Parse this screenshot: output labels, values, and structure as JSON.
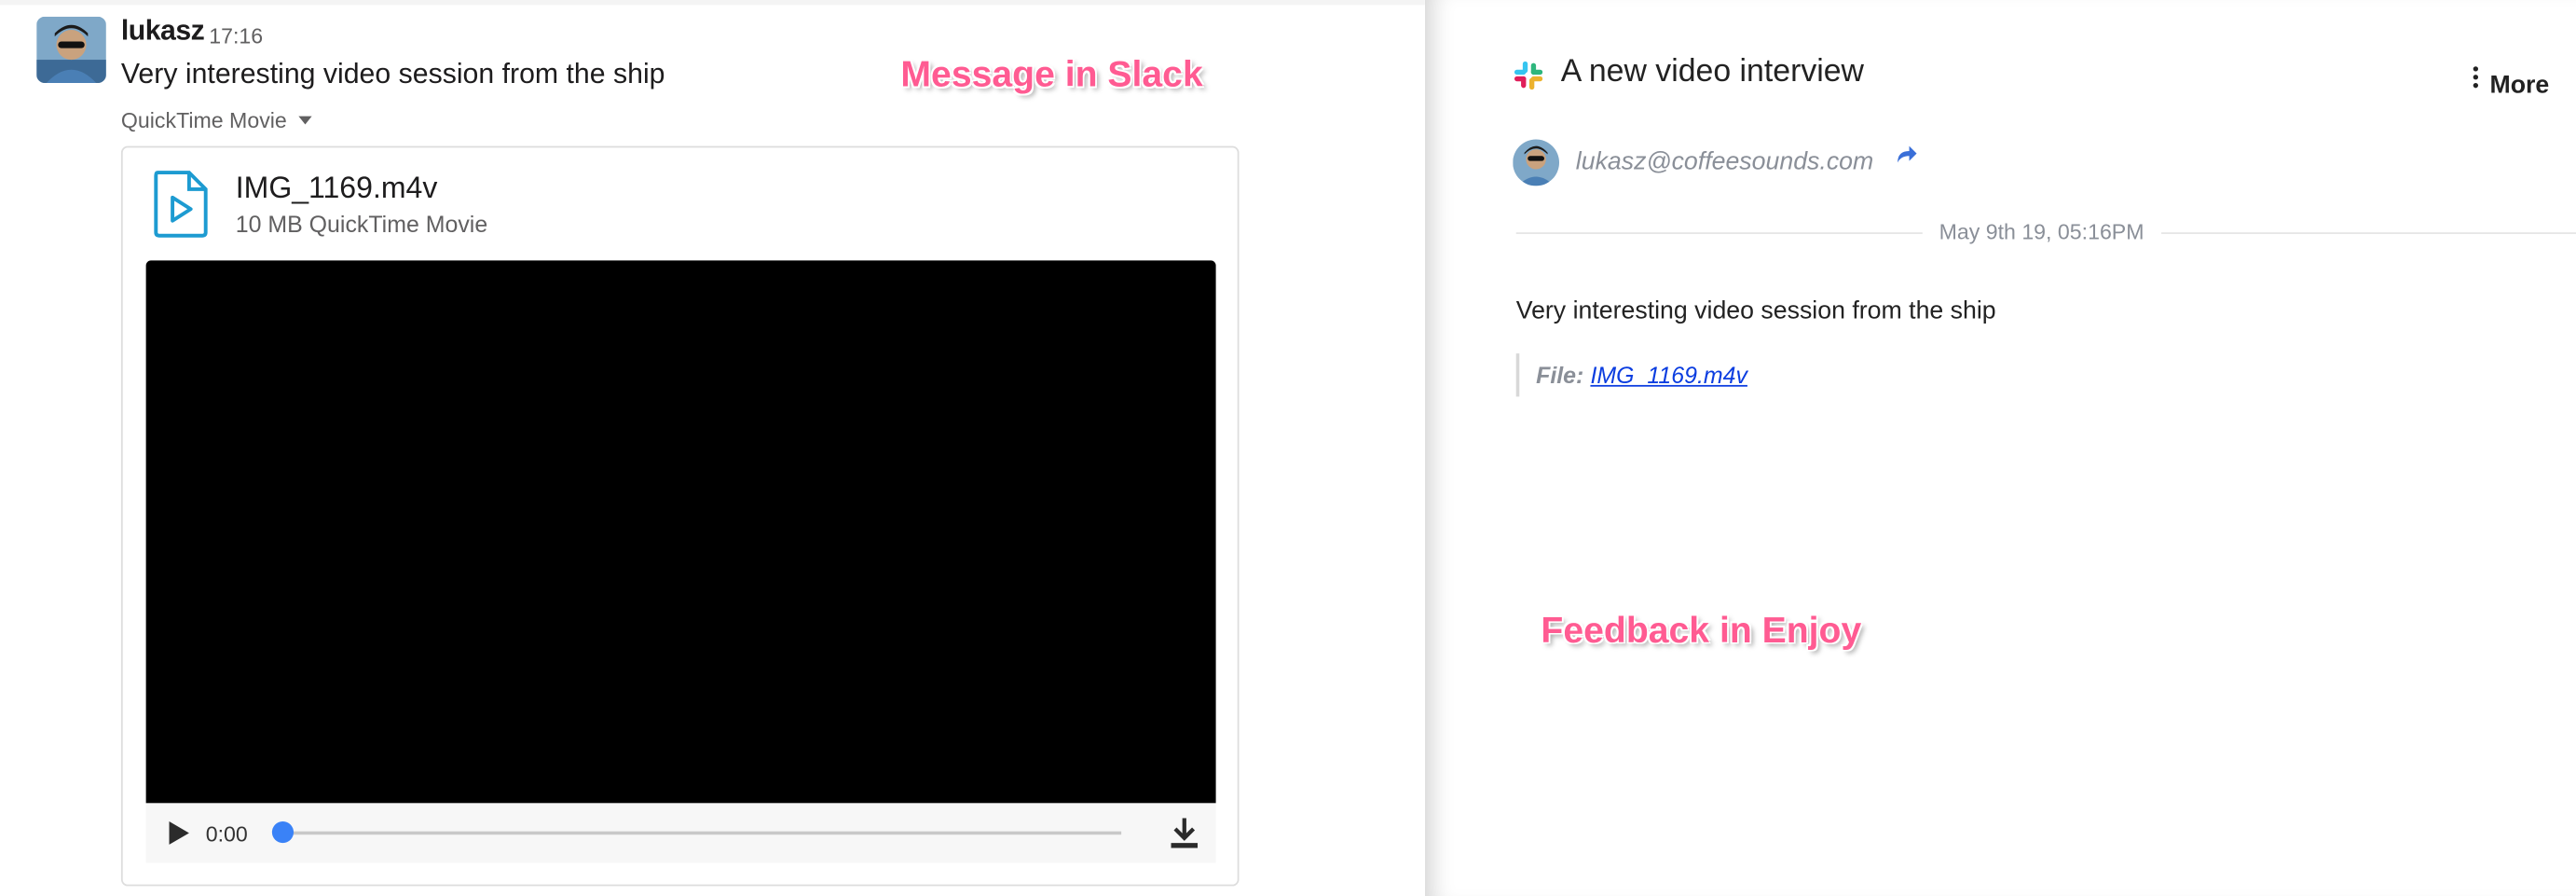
{
  "slack": {
    "username": "lukasz",
    "time": "17:16",
    "message": "Very interesting video session from the ship",
    "file_dropdown": "QuickTime Movie",
    "file": {
      "name": "IMG_1169.m4v",
      "meta": "10 MB QuickTime Movie",
      "player_time": "0:00",
      "progress": 0
    },
    "callout": "Message in Slack"
  },
  "enjoy": {
    "title": "A new video interview",
    "more_label": "More",
    "email": "lukasz@coffeesounds.com",
    "date": "May 9th 19, 05:16PM",
    "message": "Very interesting video session from the ship",
    "file_label": "File:",
    "file_link": "IMG_1169.m4v",
    "callout": "Feedback  in Enjoy"
  },
  "colors": {
    "callout": "#ff5b92",
    "player_knob": "#3a82f7",
    "link": "#0b3de0",
    "file_icon": "#1d9bd1"
  }
}
